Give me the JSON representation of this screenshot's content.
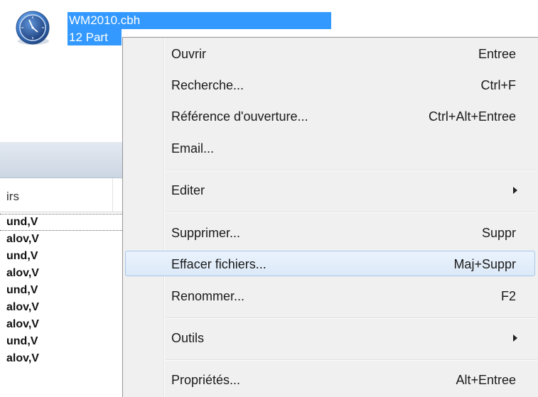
{
  "file": {
    "name": "WM2010.cbh",
    "subtitle": "12 Part",
    "icon": "clock-icon"
  },
  "list": {
    "column_header": "irs",
    "rows": [
      "und,V",
      "alov,V",
      "und,V",
      "alov,V",
      "und,V",
      "alov,V",
      "alov,V",
      "und,V",
      "alov,V"
    ]
  },
  "context_menu": {
    "items": [
      {
        "label": "Ouvrir",
        "shortcut": "Entree"
      },
      {
        "label": "Recherche...",
        "shortcut": "Ctrl+F"
      },
      {
        "label": "Référence d'ouverture...",
        "shortcut": "Ctrl+Alt+Entree"
      },
      {
        "label": "Email...",
        "shortcut": ""
      },
      {
        "label": "Editer",
        "shortcut": "",
        "submenu": true
      },
      {
        "label": "Supprimer...",
        "shortcut": "Suppr"
      },
      {
        "label": "Effacer fichiers...",
        "shortcut": "Maj+Suppr",
        "highlighted": true
      },
      {
        "label": "Renommer...",
        "shortcut": "F2"
      },
      {
        "label": "Outils",
        "shortcut": "",
        "submenu": true
      },
      {
        "label": "Propriétés...",
        "shortcut": "Alt+Entree"
      }
    ]
  },
  "colors": {
    "selection": "#3399ff",
    "menu_background": "#f0f0f0",
    "hover_border": "#a7c6ea"
  }
}
